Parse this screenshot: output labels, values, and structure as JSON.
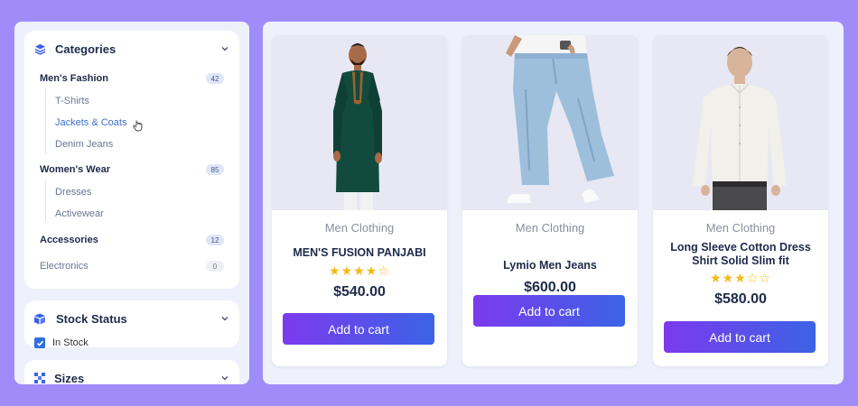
{
  "sidebar": {
    "categories": {
      "title": "Categories",
      "icon": "layers-icon",
      "items": [
        {
          "label": "Men's Fashion",
          "count": "42",
          "subitems": [
            "T-Shirts",
            "Jackets & Coats",
            "Denim Jeans"
          ]
        },
        {
          "label": "Women's Wear",
          "count": "85",
          "subitems": [
            "Dresses",
            "Activewear"
          ]
        },
        {
          "label": "Accessories",
          "count": "12",
          "subitems": []
        },
        {
          "label": "Electronics",
          "count": "0",
          "subitems": []
        }
      ],
      "active_subitem": "Jackets & Coats"
    },
    "stock": {
      "title": "Stock Status",
      "icon": "box-icon",
      "option": "In Stock",
      "checked": true
    },
    "sizes": {
      "title": "Sizes",
      "icon": "grid-icon"
    }
  },
  "products": [
    {
      "category": "Men Clothing",
      "name": "MEN'S FUSION PANJABI",
      "rating": 4,
      "max_rating": 5,
      "price": "$540.00",
      "button": "Add to cart"
    },
    {
      "category": "Men Clothing",
      "name": "Lymio Men Jeans",
      "rating": null,
      "max_rating": 5,
      "price": "$600.00",
      "button": "Add to cart"
    },
    {
      "category": "Men Clothing",
      "name": "Long Sleeve Cotton Dress Shirt Solid Slim fit",
      "rating": 3,
      "max_rating": 5,
      "price": "$580.00",
      "button": "Add to cart"
    }
  ],
  "colors": {
    "page_bg": "#a08cf8",
    "accent_gradient": [
      "#7c3aed",
      "#3b63e6"
    ],
    "star": "#f5b915",
    "active_link": "#3b6fcf"
  }
}
